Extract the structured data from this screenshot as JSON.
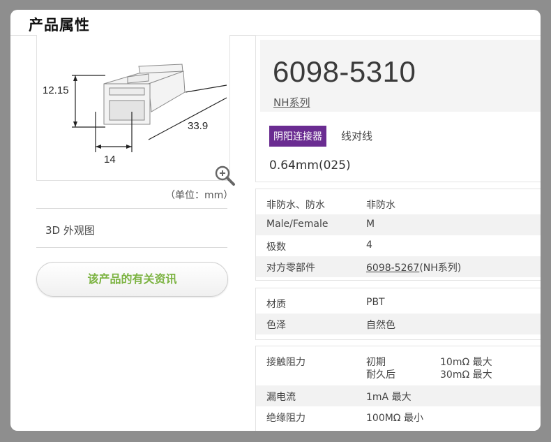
{
  "header": {
    "title": "产品属性"
  },
  "image": {
    "dimensions": {
      "height": "12.15",
      "length": "33.9",
      "width": "14"
    },
    "unit_note": "（单位：mm）",
    "zoom_icon": "zoom-in-icon"
  },
  "left_menu": {
    "view_3d": "3D 外观图",
    "info_button": "该产品的有关资讯"
  },
  "product": {
    "part_number": "6098-5310",
    "series": "NH系列",
    "tag": "阴阳连接器",
    "tag_desc": "线对线",
    "pitch": "0.64mm(025)"
  },
  "specs_general": [
    {
      "key": "非防水、防水",
      "value": "非防水"
    },
    {
      "key": "Male/Female",
      "value": "M"
    },
    {
      "key": "极数",
      "value": "4"
    },
    {
      "key": "对方零部件",
      "value_link": "6098-5267",
      "value_suffix": "(NH系列)"
    }
  ],
  "specs_material": [
    {
      "key": "材质",
      "value": "PBT"
    },
    {
      "key": "色泽",
      "value": "自然色"
    }
  ],
  "specs_electrical": {
    "contact_resistance": {
      "key": "接触阻力",
      "initial_label": "初期",
      "initial_value": "10mΩ 最大",
      "after_label": "耐久后",
      "after_value": "30mΩ 最大"
    },
    "leakage": {
      "key": "漏电流",
      "value": "1mA 最大"
    },
    "insulation": {
      "key": "绝缘阻力",
      "value": "100MΩ 最小"
    }
  },
  "colors": {
    "tag_bg": "#6a2c91",
    "info_button_text": "#7cb342",
    "backdrop": "#8e8e8e"
  }
}
